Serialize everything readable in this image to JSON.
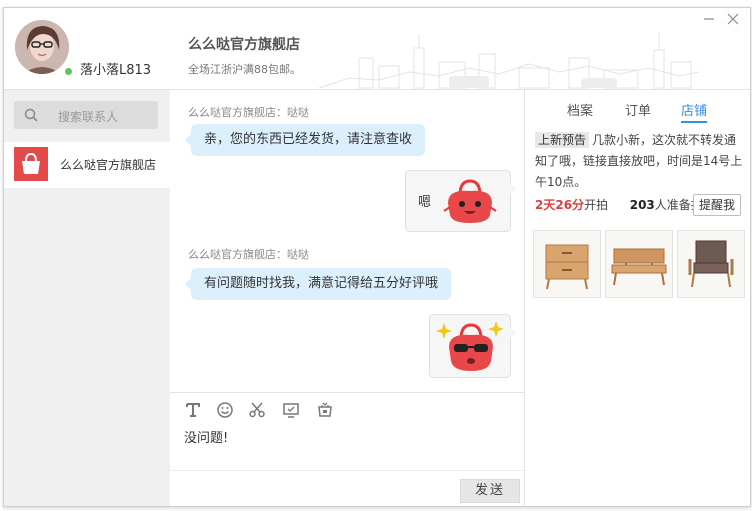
{
  "header": {
    "user_name": "落小落L813",
    "shop_title": "么么哒官方旗舰店",
    "shop_notice": "全场江浙沪满88包邮。",
    "minimize_icon": "minimize-icon",
    "close_icon": "close-icon"
  },
  "sidebar": {
    "search_placeholder": "搜索联系人",
    "contacts": [
      {
        "name": "么么哒官方旗舰店",
        "icon": "shopping-bag-icon",
        "selected": true
      }
    ]
  },
  "chat": {
    "messages": [
      {
        "sender": "么么哒官方旗舰店：哒哒",
        "text": "亲，您的东西已经发货，请注意查收",
        "direction": "in"
      },
      {
        "text": "嗯",
        "sticker": "bag-mascot-smile",
        "direction": "out"
      },
      {
        "sender": "么么哒官方旗舰店：哒哒",
        "text": "有问题随时找我，满意记得给五分好评哦",
        "direction": "in"
      },
      {
        "sticker": "bag-mascot-sunglasses",
        "direction": "out"
      }
    ]
  },
  "composer": {
    "tools": [
      "text-format-icon",
      "emoji-icon",
      "scissors-icon",
      "screenshot-icon",
      "shop-icon"
    ],
    "draft": "没问题!",
    "send_label": "发送"
  },
  "right_panel": {
    "tabs": [
      {
        "label": "档案",
        "active": false
      },
      {
        "label": "订单",
        "active": false
      },
      {
        "label": "店铺",
        "active": true
      }
    ],
    "announcement_tag": "上新预告",
    "announcement_text": "几款小新，这次就不转发通知了哦，链接直接放吧，时间是14号上午10点。",
    "countdown": "2天26分",
    "countdown_suffix": "开拍",
    "ready_count": "203",
    "ready_suffix": "人准备抢",
    "remind_label": "提醒我",
    "products": [
      "wooden-cabinet-icon",
      "wooden-bench-icon",
      "armchair-icon"
    ]
  },
  "colors": {
    "accent": "#3a8fd9",
    "incoming_bubble": "#dcf0fc",
    "brand_red": "#e44a4a",
    "countdown_red": "#e23c3c"
  }
}
